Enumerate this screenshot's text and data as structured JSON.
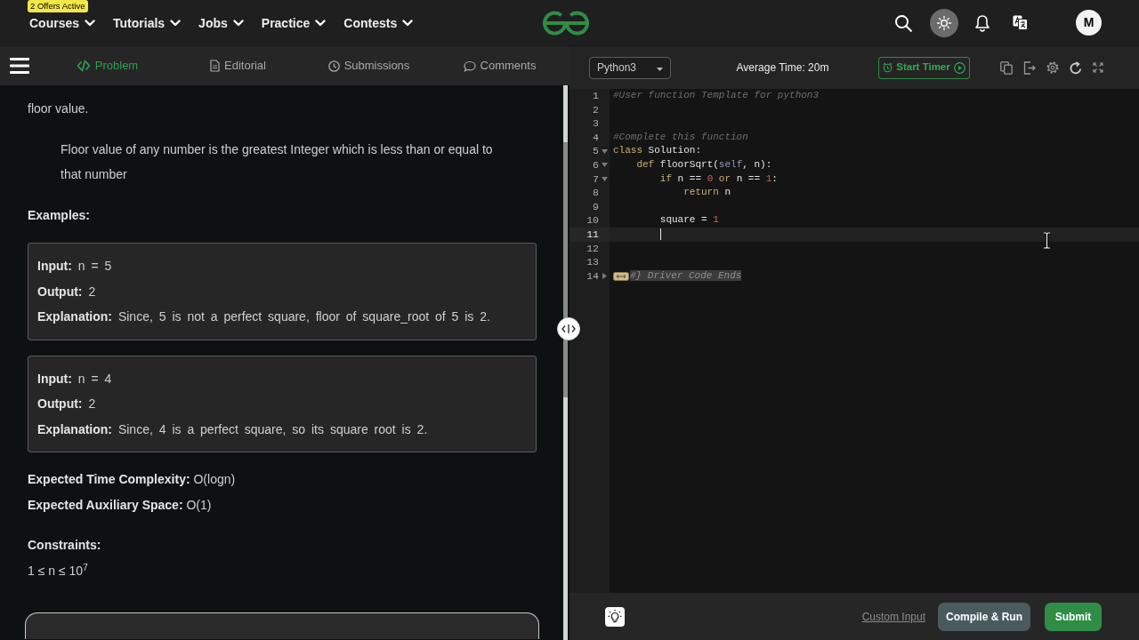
{
  "header": {
    "nav": [
      {
        "label": "Courses",
        "badge": "2 Offers Active"
      },
      {
        "label": "Tutorials"
      },
      {
        "label": "Jobs"
      },
      {
        "label": "Practice"
      },
      {
        "label": "Contests"
      }
    ],
    "avatar": "M"
  },
  "problem_panel": {
    "tabs": [
      {
        "label": "Problem",
        "selected": true
      },
      {
        "label": "Editorial",
        "selected": false
      },
      {
        "label": "Submissions",
        "selected": false
      },
      {
        "label": "Comments",
        "selected": false
      }
    ],
    "intro": "floor value.",
    "note": "Floor value of any number is the greatest Integer which is less than or equal to that number",
    "examples_heading": "Examples:",
    "examples": [
      {
        "lines": [
          "**Input:** n = 5",
          "**Output:** 2",
          "**Explanation:** Since, 5 is not a perfect square, floor of square_root of 5 is 2."
        ]
      },
      {
        "lines": [
          "**Input:** n = 4",
          "**Output:** 2",
          "**Explanation:** Since, 4 is a perfect square, so its square root is 2."
        ]
      }
    ],
    "complexity": [
      "**Expected Time Complexity:** O(logn)",
      "**Expected Auxiliary Space:** O(1)"
    ],
    "constraints_heading": "Constraints:",
    "constraints": "1 ≤ n ≤ 10$^{7}$"
  },
  "editor": {
    "language": "Python3",
    "average_time": "Average Time: 20m",
    "timer_button": "Start Timer",
    "lines": [
      {
        "number": "1",
        "tokens": [
          {
            "kind": "comment",
            "text": "#User function Template for python3"
          }
        ]
      },
      {
        "number": "2"
      },
      {
        "number": "3"
      },
      {
        "number": "4",
        "tokens": [
          {
            "kind": "comment",
            "text": "#Complete this function"
          }
        ]
      },
      {
        "number": "5",
        "folded": false,
        "tokens": [
          {
            "kind": "keyword",
            "text": "class"
          },
          {
            "kind": "plain",
            "text": " Solution:"
          }
        ]
      },
      {
        "number": "6",
        "folded": false,
        "tokens": [
          {
            "kind": "keyword",
            "text": "    def"
          },
          {
            "kind": "plain",
            "text": " floorSqrt("
          },
          {
            "kind": "self",
            "text": "self"
          },
          {
            "kind": "plain",
            "text": ", n):"
          }
        ]
      },
      {
        "number": "7",
        "folded": false,
        "tokens": [
          {
            "kind": "keyword",
            "text": "        if"
          },
          {
            "kind": "plain",
            "text": " n == "
          },
          {
            "kind": "number",
            "text": "0"
          },
          {
            "kind": "keyword",
            "text": " or"
          },
          {
            "kind": "plain",
            "text": " n == "
          },
          {
            "kind": "number",
            "text": "1"
          },
          {
            "kind": "plain",
            "text": ":"
          }
        ]
      },
      {
        "number": "8",
        "tokens": [
          {
            "kind": "keyword",
            "text": "            return"
          },
          {
            "kind": "plain",
            "text": " n"
          }
        ]
      },
      {
        "number": "9"
      },
      {
        "number": "10",
        "tokens": [
          {
            "kind": "plain",
            "text": "        square = "
          },
          {
            "kind": "number",
            "text": "1"
          }
        ]
      },
      {
        "number": "11",
        "current": true
      },
      {
        "number": "12"
      },
      {
        "number": "13"
      },
      {
        "number": "14",
        "folded": true,
        "tokens": [
          {
            "kind": "folded",
            "text": "#} Driver Code Ends"
          }
        ]
      }
    ],
    "custom_input": "Custom Input",
    "buttons": [
      {
        "label": "Compile & Run",
        "kind": "secondary"
      },
      {
        "label": "Submit",
        "kind": "primary"
      }
    ]
  }
}
